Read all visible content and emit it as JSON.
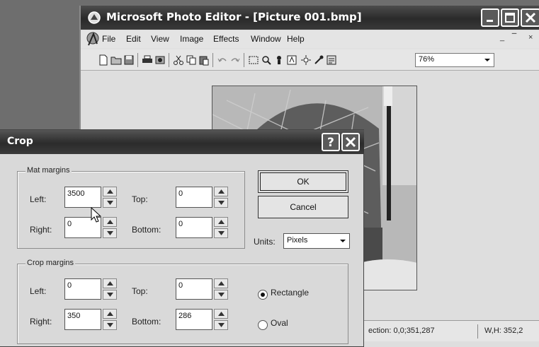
{
  "main_window": {
    "title": "Microsoft Photo Editor - [Picture 001.bmp]",
    "menu": [
      "File",
      "Edit",
      "View",
      "Image",
      "Effects",
      "Window",
      "Help"
    ],
    "doc_controls": [
      "_",
      "̅̅",
      "×"
    ],
    "zoom": {
      "value": "76%"
    },
    "status": {
      "selection": "ection: 0,0;351,287",
      "size": "W,H: 352,2"
    }
  },
  "crop_dialog": {
    "title": "Crop",
    "mat_margins": {
      "label": "Mat margins",
      "left_label": "Left:",
      "left_value": "3500",
      "right_label": "Right:",
      "right_value": "0",
      "top_label": "Top:",
      "top_value": "0",
      "bottom_label": "Bottom:",
      "bottom_value": "0"
    },
    "crop_margins": {
      "label": "Crop margins",
      "left_label": "Left:",
      "left_value": "0",
      "right_label": "Right:",
      "right_value": "350",
      "top_label": "Top:",
      "top_value": "0",
      "bottom_label": "Bottom:",
      "bottom_value": "286"
    },
    "ok_label": "OK",
    "cancel_label": "Cancel",
    "units_label": "Units:",
    "units_value": "Pixels",
    "shape_options": [
      {
        "label": "Rectangle",
        "selected": true
      },
      {
        "label": "Oval",
        "selected": false
      }
    ]
  }
}
